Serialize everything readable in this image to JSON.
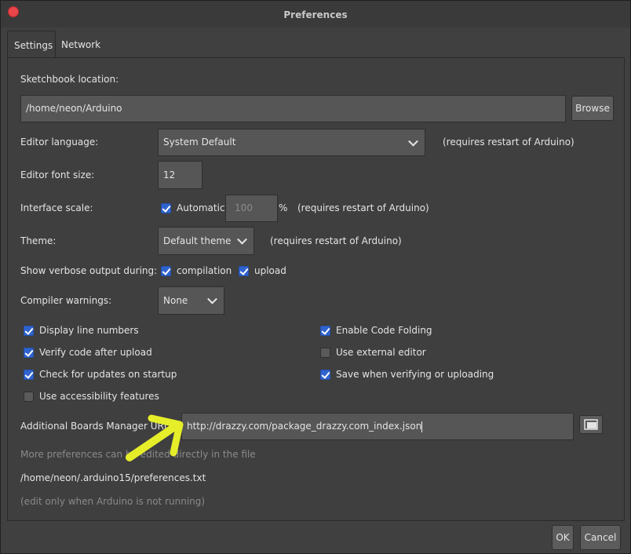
{
  "window": {
    "title": "Preferences"
  },
  "tabs": [
    {
      "label": "Settings"
    },
    {
      "label": "Network"
    }
  ],
  "sketchbook": {
    "label": "Sketchbook location:",
    "value": "/home/neon/Arduino",
    "browse": "Browse"
  },
  "editor_language": {
    "label": "Editor language:",
    "value": "System Default",
    "note": "(requires restart of Arduino)"
  },
  "editor_font_size": {
    "label": "Editor font size:",
    "value": "12"
  },
  "interface_scale": {
    "label": "Interface scale:",
    "automatic": "Automatic",
    "value": "100",
    "unit": "%",
    "note": "(requires restart of Arduino)"
  },
  "theme": {
    "label": "Theme:",
    "value": "Default theme",
    "note": "(requires restart of Arduino)"
  },
  "verbose": {
    "label": "Show verbose output during:",
    "compilation": "compilation",
    "upload": "upload"
  },
  "compiler_warnings": {
    "label": "Compiler warnings:",
    "value": "None"
  },
  "checkboxes": {
    "display_line_numbers": {
      "label": "Display line numbers",
      "checked": true
    },
    "enable_code_folding": {
      "label": "Enable Code Folding",
      "checked": true
    },
    "verify_after_upload": {
      "label": "Verify code after upload",
      "checked": true
    },
    "use_external_editor": {
      "label": "Use external editor",
      "checked": false
    },
    "check_updates": {
      "label": "Check for updates on startup",
      "checked": true
    },
    "save_when_verifying": {
      "label": "Save when verifying or uploading",
      "checked": true
    },
    "accessibility": {
      "label": "Use accessibility features",
      "checked": false
    }
  },
  "boards_manager": {
    "label": "Additional Boards Manager URLs:",
    "value": "http://drazzy.com/package_drazzy.com_index.json"
  },
  "info": {
    "more_prefs": "More preferences can be edited directly in the file",
    "path": "/home/neon/.arduino15/preferences.txt",
    "edit_note": "(edit only when Arduino is not running)"
  },
  "footer": {
    "ok": "OK",
    "cancel": "Cancel"
  },
  "colors": {
    "checkbox_on": "#2f63cf",
    "annotation_arrow": "#e6ee2a",
    "close_button": "#e8464a"
  }
}
